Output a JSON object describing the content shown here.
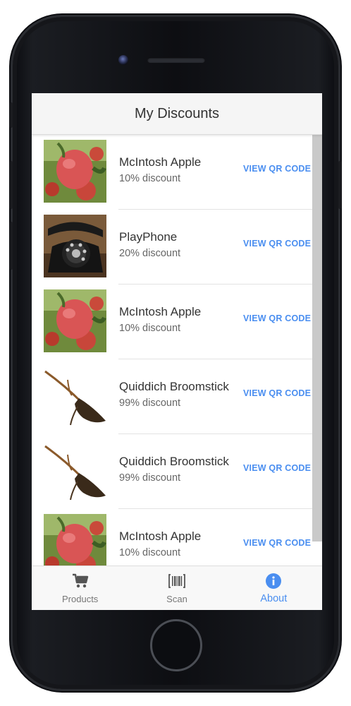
{
  "header": {
    "title": "My Discounts"
  },
  "discounts": [
    {
      "name": "McIntosh Apple",
      "discount": "10% discount",
      "action": "VIEW QR CODE",
      "image": "apple-image"
    },
    {
      "name": "PlayPhone",
      "discount": "20% discount",
      "action": "VIEW QR CODE",
      "image": "rotary-phone-image"
    },
    {
      "name": "McIntosh Apple",
      "discount": "10% discount",
      "action": "VIEW QR CODE",
      "image": "apple-image"
    },
    {
      "name": "Quiddich Broomstick",
      "discount": "99% discount",
      "action": "VIEW QR CODE",
      "image": "broomstick-image"
    },
    {
      "name": "Quiddich Broomstick",
      "discount": "99% discount",
      "action": "VIEW QR CODE",
      "image": "broomstick-image"
    },
    {
      "name": "McIntosh Apple",
      "discount": "10% discount",
      "action": "VIEW QR CODE",
      "image": "apple-image"
    }
  ],
  "tabs": [
    {
      "label": "Products",
      "icon": "cart-icon",
      "active": false
    },
    {
      "label": "Scan",
      "icon": "barcode-icon",
      "active": false
    },
    {
      "label": "About",
      "icon": "info-icon",
      "active": true
    }
  ],
  "colors": {
    "accent": "#4a8ef0",
    "header_bg": "#f5f5f5",
    "text": "#333333"
  }
}
